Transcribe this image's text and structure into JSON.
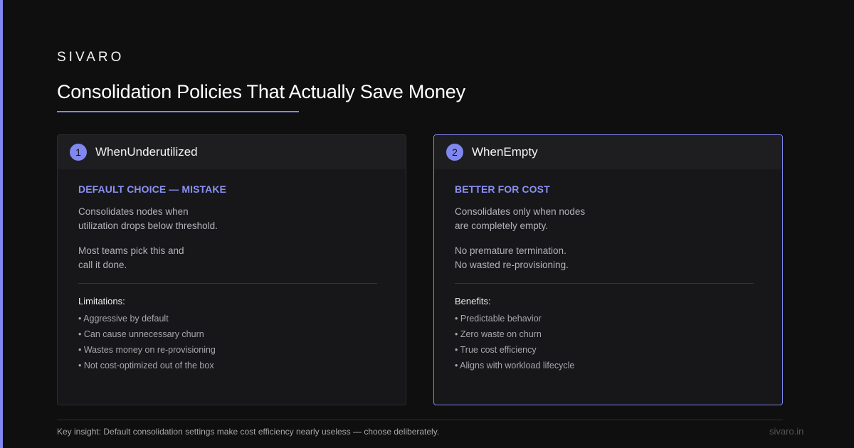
{
  "brand": "SIVARO",
  "title": "Consolidation Policies That Actually Save Money",
  "colors": {
    "accent": "#8088f0",
    "background": "#0f0f10",
    "card": "#17171a"
  },
  "cards": [
    {
      "number": "1",
      "name": "WhenUnderutilized",
      "kicker": "DEFAULT CHOICE — MISTAKE",
      "para1": "Consolidates nodes when\nutilization drops below threshold.",
      "para2": "Most teams pick this and\ncall it done.",
      "list_title": "Limitations:",
      "items": [
        "• Aggressive by default",
        "• Can cause unnecessary churn",
        "• Wastes money on re-provisioning",
        "• Not cost-optimized out of the box"
      ]
    },
    {
      "number": "2",
      "name": "WhenEmpty",
      "kicker": "BETTER FOR COST",
      "para1": "Consolidates only when nodes\nare completely empty.",
      "para2": "No premature termination.\nNo wasted re-provisioning.",
      "list_title": "Benefits:",
      "items": [
        "• Predictable behavior",
        "• Zero waste on churn",
        "• True cost efficiency",
        "• Aligns with workload lifecycle"
      ]
    }
  ],
  "footer": {
    "insight": "Key insight: Default consolidation settings make cost efficiency nearly useless — choose deliberately.",
    "url": "sivaro.in"
  }
}
